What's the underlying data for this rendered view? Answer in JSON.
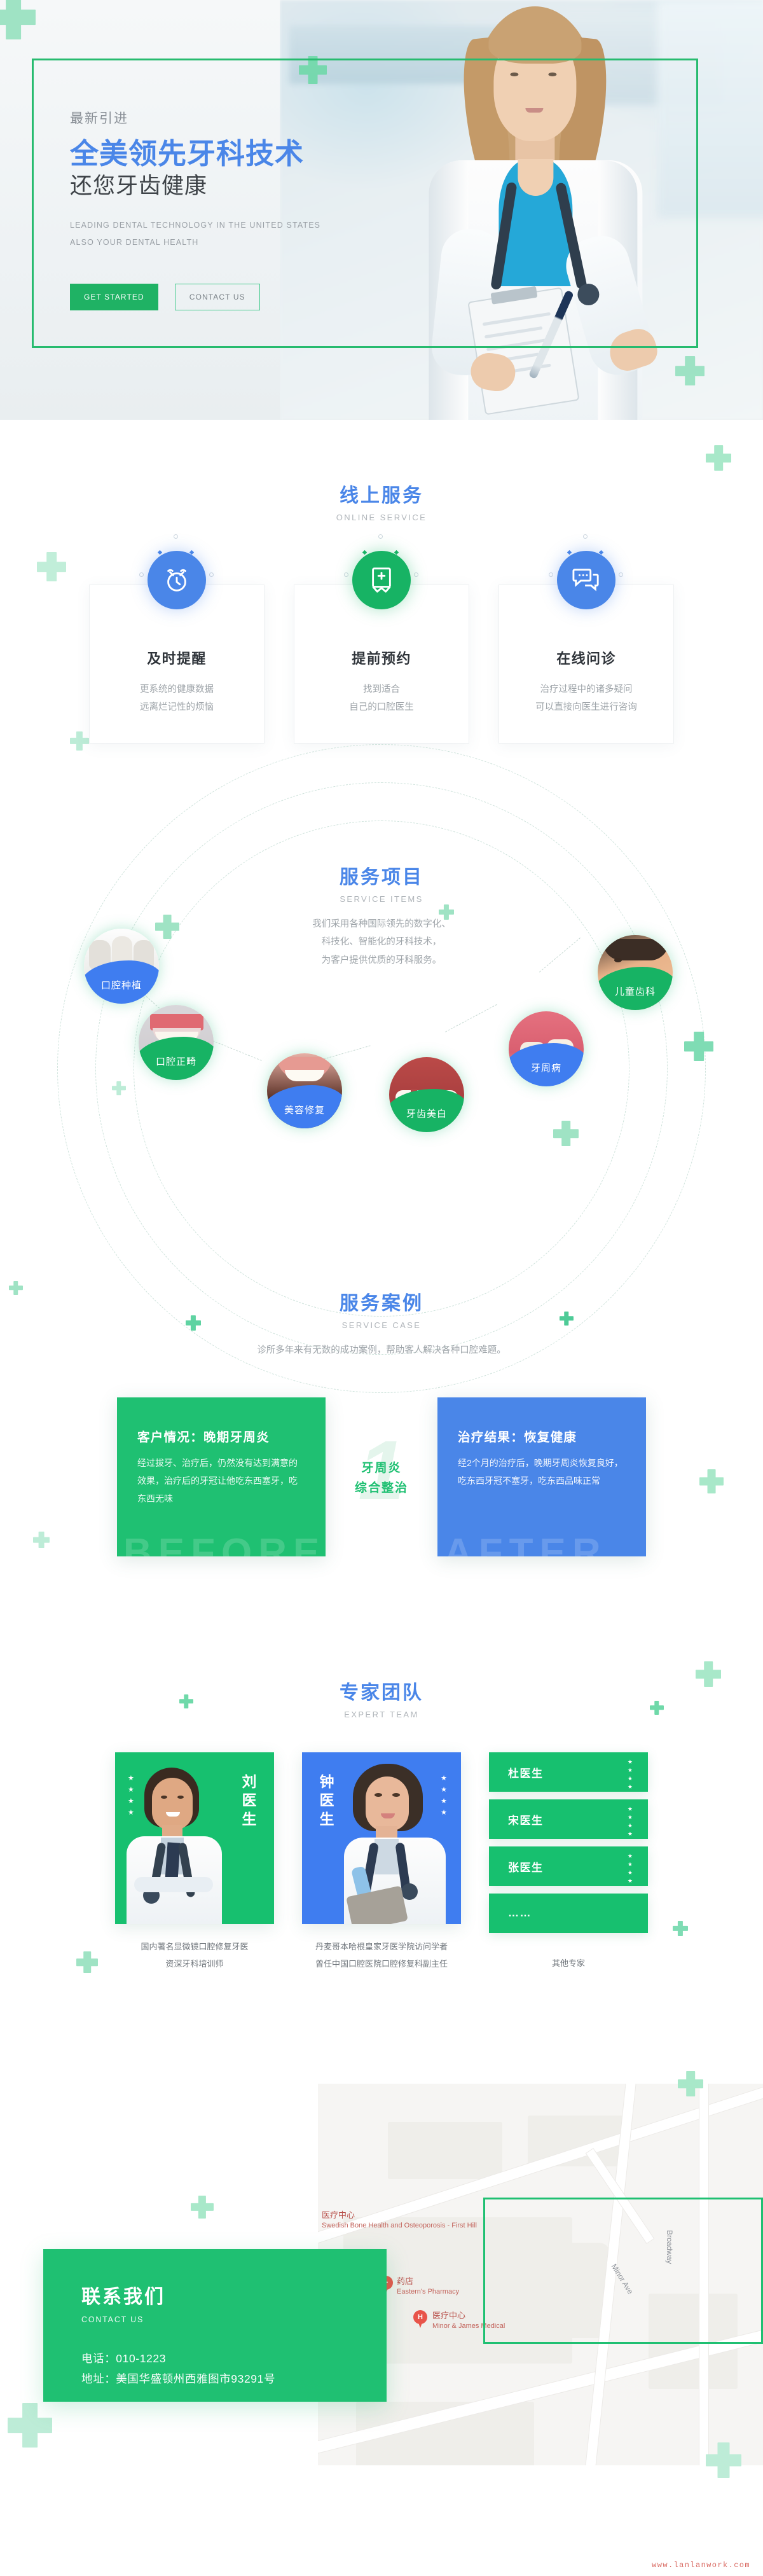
{
  "hero": {
    "eyebrow": "最新引进",
    "title": "全美领先牙科技术",
    "subtitle": "还您牙齿健康",
    "en_line1": "LEADING DENTAL TECHNOLOGY IN THE UNITED STATES",
    "en_line2": "ALSO YOUR DENTAL HEALTH",
    "btn_primary": "GET STARTED",
    "btn_secondary": "CONTACT US"
  },
  "online_service": {
    "title_cn": "线上服务",
    "title_en": "ONLINE SERVICE",
    "cards": [
      {
        "icon": "alarm-clock-icon",
        "icon_color": "#4a86e8",
        "title": "及时提醒",
        "line1": "更系统的健康数据",
        "line2": "远离烂记性的烦恼"
      },
      {
        "icon": "medical-book-icon",
        "icon_color": "#17b364",
        "title": "提前预约",
        "line1": "找到适合",
        "line2": "自己的口腔医生"
      },
      {
        "icon": "chat-bubble-icon",
        "icon_color": "#4a86e8",
        "title": "在线问诊",
        "line1": "治疗过程中的诸多疑问",
        "line2": "可以直接向医生进行咨询"
      }
    ]
  },
  "service_items": {
    "title_cn": "服务项目",
    "title_en": "SERVICE ITEMS",
    "desc_line1": "我们采用各种国际领先的数字化、",
    "desc_line2": "科技化、智能化的牙科技术，",
    "desc_line3": "为客户提供优质的牙科服务。",
    "items": [
      {
        "label": "口腔种植",
        "color": "#3f7df0"
      },
      {
        "label": "口腔正畸",
        "color": "#17b364"
      },
      {
        "label": "美容修复",
        "color": "#3f7df0"
      },
      {
        "label": "牙齿美白",
        "color": "#17b364"
      },
      {
        "label": "牙周病",
        "color": "#3f7df0"
      },
      {
        "label": "儿童齿科",
        "color": "#17b364"
      }
    ]
  },
  "service_case": {
    "title_cn": "服务案例",
    "title_en": "SERVICE CASE",
    "desc": "诊所多年来有无数的成功案例，帮助客人解决各种口腔难题。",
    "before": {
      "heading": "客户情况：晚期牙周炎",
      "body": "经过拔牙、治疗后，仍然没有达到满意的效果，治疗后的牙冠让他吃东西塞牙，吃东西无味",
      "watermark": "BEFORE",
      "color": "#1fc072"
    },
    "middle": {
      "number": "1",
      "line1": "牙周炎",
      "line2": "综合整治"
    },
    "after": {
      "heading": "治疗结果：恢复健康",
      "body": "经2个月的治疗后，晚期牙周炎恢复良好，吃东西牙冠不塞牙，吃东西品味正常",
      "watermark": "AFTER",
      "color": "#4a86e8"
    }
  },
  "expert_team": {
    "title_cn": "专家团队",
    "title_en": "EXPERT TEAM",
    "doctors": [
      {
        "name": "刘医生",
        "theme": "green",
        "stars": 4,
        "caption_line1": "国内著名显微镜口腔修复牙医",
        "caption_line2": "资深牙科培训师"
      },
      {
        "name": "钟医生",
        "theme": "blue",
        "stars": 4,
        "caption_line1": "丹麦哥本哈根皇家牙医学院访问学者",
        "caption_line2": "曾任中国口腔医院口腔修复科副主任"
      }
    ],
    "others": [
      {
        "label": "杜医生",
        "stars": 4
      },
      {
        "label": "宋医生",
        "stars": 4
      },
      {
        "label": "张医生",
        "stars": 4
      },
      {
        "label": "……",
        "stars": 0
      }
    ],
    "others_caption": "其他专家"
  },
  "contact": {
    "title_cn": "联系我们",
    "title_en": "CONTACT US",
    "phone": "电话：010-1223",
    "address": "地址：美国华盛顿州西雅图市93291号",
    "map": {
      "labels": [
        {
          "cn": "医疗中心",
          "en": "Swedish Bone Health and Osteoporosis - First Hill",
          "pin": "H"
        },
        {
          "cn": "药店",
          "en": "Eastern's Pharmacy",
          "pin": "+"
        },
        {
          "cn": "医疗中心",
          "en": "Minor & James Medical",
          "pin": "H"
        }
      ],
      "streets": [
        "Minor Ave",
        "Broadway"
      ]
    }
  },
  "footer": {
    "watermark": "www.lanlanwork.com"
  },
  "theme": {
    "green": "#1fc072",
    "blue": "#4a86e8",
    "green_dark": "#17b364",
    "text_dark": "#2f343a",
    "text_muted": "#9ea4a9"
  }
}
